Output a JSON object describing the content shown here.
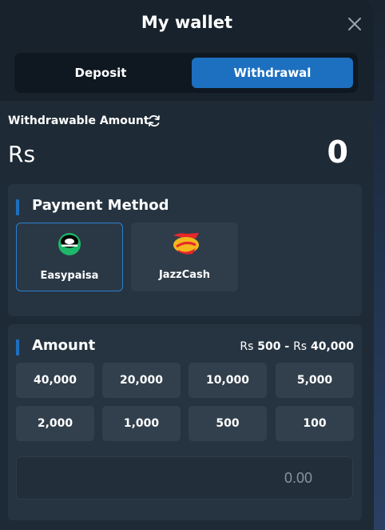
{
  "header": {
    "title": "My wallet"
  },
  "tabs": [
    {
      "label": "Deposit",
      "active": false
    },
    {
      "label": "Withdrawal",
      "active": true
    }
  ],
  "balance": {
    "label": "Withdrawable Amount",
    "currency": "Rs",
    "value": "0"
  },
  "payment": {
    "title": "Payment Method",
    "methods": [
      {
        "label": "Easypaisa",
        "icon": "easypaisa-logo",
        "selected": true
      },
      {
        "label": "JazzCash",
        "icon": "jazzcash-logo",
        "selected": false
      }
    ]
  },
  "amount": {
    "title": "Amount",
    "range_currency_min": "Rs",
    "range_min": "500",
    "range_sep": "-",
    "range_currency_max": "Rs",
    "range_max": "40,000",
    "presets": [
      "40,000",
      "20,000",
      "10,000",
      "5,000",
      "2,000",
      "1,000",
      "500",
      "100"
    ],
    "input_placeholder": "0.00"
  },
  "colors": {
    "accent": "#1d70c0",
    "panel": "#1e2a35",
    "card": "#263441"
  }
}
